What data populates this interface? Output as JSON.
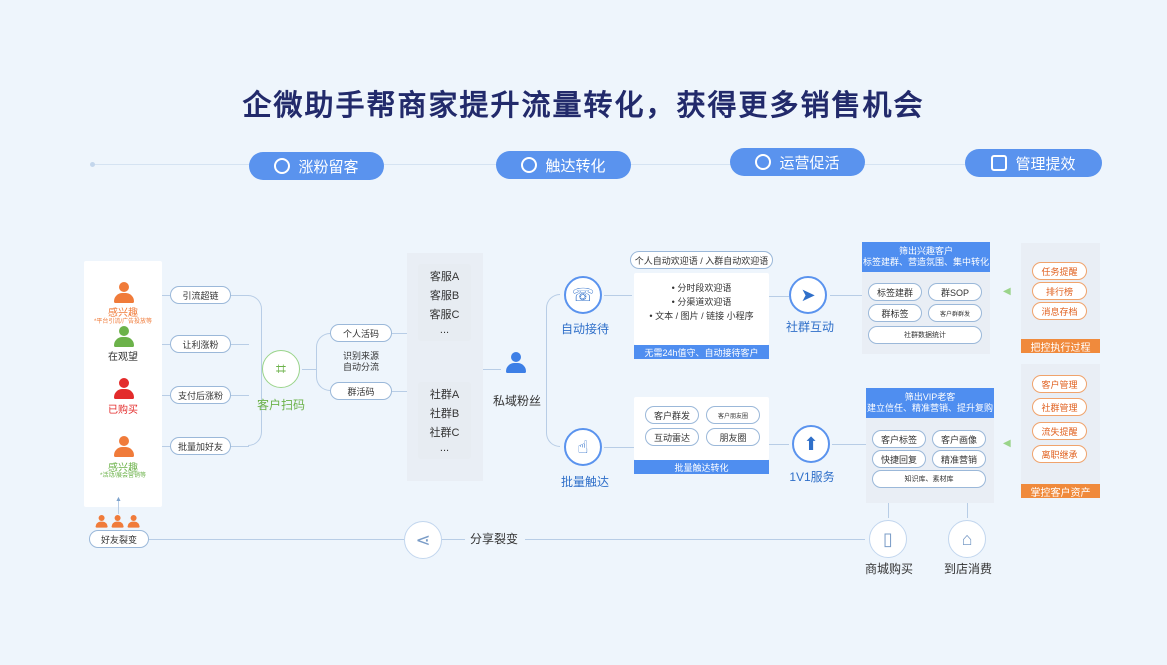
{
  "title": "企微助手帮商家提升流量转化，获得更多销售机会",
  "phases": [
    {
      "label": "涨粉留客"
    },
    {
      "label": "触达转化"
    },
    {
      "label": "运营促活"
    },
    {
      "label": "管理提效"
    }
  ],
  "customers": [
    {
      "label": "感兴趣",
      "note": "*平台引流/广告投放等",
      "color": "#f07b3a"
    },
    {
      "label": "在观望",
      "color": "#6cb24a"
    },
    {
      "label": "已购买",
      "color": "#e32b2b"
    },
    {
      "label": "感兴趣",
      "note": "*活动/展会营销等",
      "color": "#f07b3a"
    }
  ],
  "referral": {
    "label": "好友裂变"
  },
  "channels": [
    "引流超链",
    "让利涨粉",
    "支付后涨粉",
    "批量加好友"
  ],
  "scan": {
    "label": "客户扫码"
  },
  "codes": {
    "personal": "个人活码",
    "source": "识别来源\n自动分流",
    "group": "群活码"
  },
  "service_staff": [
    "客服A",
    "客服B",
    "客服C",
    "..."
  ],
  "community_groups": [
    "社群A",
    "社群B",
    "社群C",
    "..."
  ],
  "private_fans": {
    "label": "私域粉丝"
  },
  "auto_reception": {
    "label": "自动接待",
    "header": "个人自动欢迎语 / 入群自动欢迎语",
    "items": [
      "• 分时段欢迎语",
      "• 分渠道欢迎语",
      "• 文本 / 图片 / 链接 小程序"
    ],
    "footer": "无需24h值守、自动接待客户"
  },
  "batch_reach": {
    "label": "批量触达",
    "pills": [
      "客户群发",
      "客户朋友圈",
      "互动雷达",
      "朋友圈"
    ],
    "footer": "批量触达转化"
  },
  "community_interaction": {
    "label": "社群互动",
    "header": "筛出兴趣客户\n标签建群、营造氛围、集中转化",
    "pills": [
      "标签建群",
      "群SOP",
      "群标签",
      "客户群群发",
      "社群数据统计"
    ]
  },
  "one_on_one": {
    "label": "1V1服务",
    "header": "筛出VIP老客\n建立信任、精准营销、提升复购",
    "pills": [
      "客户标签",
      "客户画像",
      "快捷回复",
      "精准营销",
      "知识库、素材库"
    ]
  },
  "management_top": {
    "items": [
      "任务提醒",
      "排行榜",
      "消息存档"
    ],
    "footer": "把控执行过程"
  },
  "management_bottom": {
    "items": [
      "客户管理",
      "社群管理",
      "流失提醒",
      "离职继承"
    ],
    "footer": "掌控客户资产"
  },
  "share": {
    "label": "分享裂变"
  },
  "outcomes": [
    {
      "label": "商城购买"
    },
    {
      "label": "到店消费"
    }
  ],
  "colors": {
    "primary": "#5a93ee",
    "title": "#222a6b",
    "orange": "#f08a3c",
    "background": "#eef5fc"
  }
}
